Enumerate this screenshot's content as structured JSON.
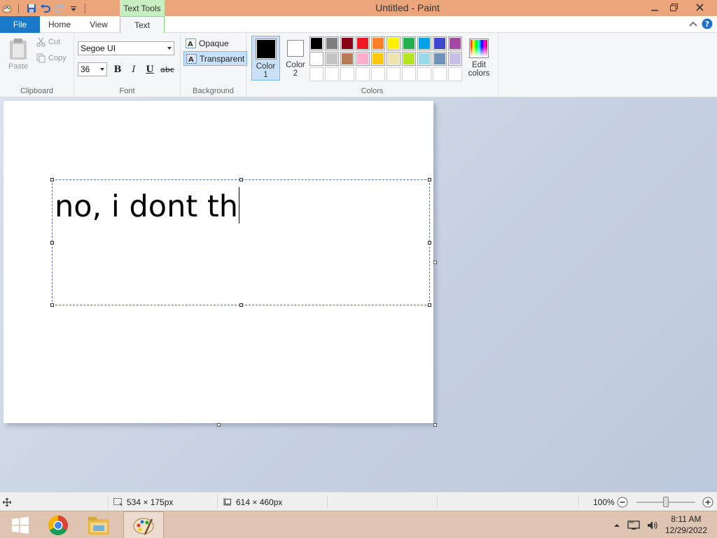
{
  "window": {
    "title": "Untitled - Paint",
    "contextual_tab_header": "Text Tools"
  },
  "ribbon_tabs": {
    "file": "File",
    "home": "Home",
    "view": "View",
    "text": "Text",
    "active": "Text"
  },
  "clipboard": {
    "paste_label": "Paste",
    "cut_label": "Cut",
    "copy_label": "Copy",
    "group_label": "Clipboard"
  },
  "font": {
    "family": "Segoe UI",
    "size": "36",
    "bold_label": "B",
    "italic_label": "I",
    "underline_label": "U",
    "strike_label": "abc",
    "group_label": "Font"
  },
  "background": {
    "opaque_label": "Opaque",
    "transparent_label": "Transparent",
    "selected": "Transparent",
    "group_label": "Background"
  },
  "colors": {
    "color1_label": "Color 1",
    "color1_value": "#000000",
    "color2_label": "Color 2",
    "color2_value": "#ffffff",
    "edit_colors_label": "Edit colors",
    "group_label": "Colors",
    "palette_row1": [
      "#000000",
      "#7f7f7f",
      "#880015",
      "#ed1c24",
      "#ff7f27",
      "#fff200",
      "#22b14c",
      "#00a2e8",
      "#3f48cc",
      "#a349a4"
    ],
    "palette_row2": [
      "#ffffff",
      "#c3c3c3",
      "#b97a57",
      "#ffaec9",
      "#ffc90e",
      "#efe4b0",
      "#b5e61d",
      "#99d9ea",
      "#7092be",
      "#c8bfe7"
    ],
    "palette_row3_empty": 10
  },
  "canvas": {
    "typed_text": "no, i dont th"
  },
  "statusbar": {
    "selection_size": "534 × 175px",
    "canvas_size": "614 × 460px",
    "zoom": "100%",
    "zoom_fraction": 0.5
  },
  "taskbar": {
    "time": "8:11 AM",
    "date": "12/29/2022"
  }
}
